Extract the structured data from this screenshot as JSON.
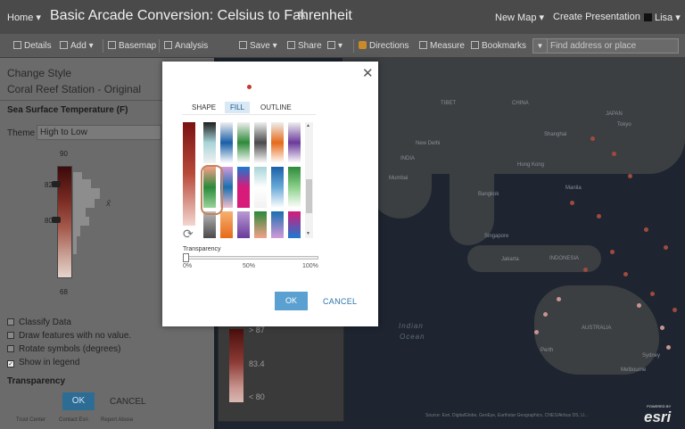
{
  "header": {
    "home": "Home ▾",
    "title": "Basic Arcade Conversion: Celsius to Fahrenheit",
    "new_map": "New Map ▾",
    "create_presentation": "Create Presentation",
    "user": "Lisa ▾"
  },
  "toolbar": {
    "details": "Details",
    "add": "Add ▾",
    "basemap": "Basemap",
    "analysis": "Analysis",
    "save": "Save ▾",
    "share": "Share",
    "print": "▾",
    "directions": "Directions",
    "measure": "Measure",
    "bookmarks": "Bookmarks",
    "search_placeholder": "Find address or place"
  },
  "left_panel": {
    "change_style": "Change Style",
    "layer_name": "Coral Reef Station - Original",
    "field": "Sea Surface Temperature (F)",
    "theme_label": "Theme",
    "theme_value": "High to Low",
    "hist_max": "90",
    "hist_h1": "82",
    "hist_h2": "80",
    "hist_min": "68",
    "mean_symbol": "x̄",
    "options": [
      {
        "label": "Classify Data",
        "checked": false
      },
      {
        "label": "Draw features with no value.",
        "checked": false
      },
      {
        "label": "Rotate symbols (degrees)",
        "checked": false
      },
      {
        "label": "Show in legend",
        "checked": true
      }
    ],
    "transparency": "Transparency",
    "ok": "OK",
    "cancel": "CANCEL",
    "footer": [
      "Trust Center",
      "Contact Esri",
      "Report Abuse"
    ]
  },
  "legend": {
    "values": [
      "> 87",
      "83.4",
      "< 80"
    ]
  },
  "map": {
    "labels": [
      "TIBET",
      "CHINA",
      "JAPAN",
      "INDIA",
      "New Delhi",
      "Shanghai",
      "Tokyo",
      "Hong Kong",
      "Mumbai",
      "Bangkok",
      "Manila",
      "Singapore",
      "Jakarta",
      "INDONESIA",
      "AUSTRALIA",
      "Sydney",
      "Melbourne",
      "Perth"
    ],
    "ocean_label": [
      "Indian",
      "Ocean"
    ],
    "attribution": "Source: Esri, DigitalGlobe, GeoEye, Earthstar Geographics, CNES/Airbus DS, U...",
    "powered_by": "POWERED BY",
    "esri": "esri"
  },
  "dialog": {
    "tabs": [
      "SHAPE",
      "FILL",
      "OUTLINE"
    ],
    "active_tab": "FILL",
    "transparency_label": "Transparency",
    "ticks": [
      "0%",
      "50%",
      "100%"
    ],
    "transparency_value": 0,
    "ok": "OK",
    "cancel": "CANCEL",
    "ramps": [
      [
        "#1e1e1e",
        "#a8d4d8",
        "#ffffff",
        "#f2f2f2"
      ],
      [
        "#f0f0f0",
        "#1a5fa8",
        "#6aaad8",
        "#ffffff"
      ],
      [
        "#f0f0f0",
        "#2e8a3a",
        "#8ad08a",
        "#ffffff"
      ],
      [
        "#f0f0f0",
        "#4a4a4a",
        "#bbbbbb",
        "#ffffff"
      ],
      [
        "#f0f0f0",
        "#e66a1a",
        "#f7b070",
        "#ffffff"
      ],
      [
        "#f0f0f0",
        "#6a3a9a",
        "#b89ad4",
        "#ffffff"
      ],
      [
        "#e23b2a",
        "#f6a08a",
        "#2a8a3a",
        "#9ad49a"
      ],
      [
        "#8a2a9a",
        "#d49ad8",
        "#1a6fb0",
        "#f2c0d0"
      ],
      [
        "#e86a1a",
        "#1a7ad0",
        "#d81a7a",
        "#d81a7a"
      ]
    ]
  }
}
